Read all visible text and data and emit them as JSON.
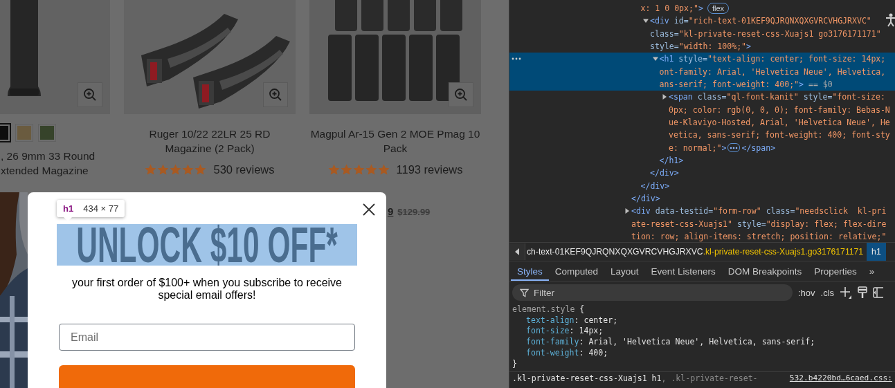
{
  "page": {
    "products": [
      {
        "swatches": [
          {
            "color": "#0e0e0e",
            "selected": true
          },
          {
            "color": "#6a5b3f",
            "selected": false
          },
          {
            "color": "#36432a",
            "selected": false
          }
        ],
        "title_lines": [
          ", 26 9mm 33 Round",
          "xtended Magazine"
        ]
      },
      {
        "title_lines": [
          "Ruger 10/22 22LR 25 RD",
          "Magazine (2 Pack)"
        ],
        "stars": 5,
        "reviews": "530 reviews"
      },
      {
        "title_lines": [
          "Magpul Ar-15 Gen 2 MOE Pmag 10",
          "Pack"
        ],
        "stars": 5,
        "reviews": "1193 reviews",
        "price": {
          "sale": "9",
          "regular": "$129.99"
        }
      }
    ]
  },
  "popup": {
    "inspect_tooltip": {
      "tag": "h1",
      "size": "434 × 77"
    },
    "heading": "UNLOCK $10 OFF*",
    "heading_highlighted": true,
    "description": "your first order of $100+ when you subscribe to receive special email offers!",
    "email_field": {
      "placeholder": "Email"
    }
  },
  "devtools": {
    "elements_tree": [
      {
        "children": [
          {
            "lines": [
              [
                {
                  "kind": "code",
                  "tokens": [
                    {
                      "kind": "value",
                      "text": "x: 1 0 0px;\""
                    },
                    {
                      "kind": "tag",
                      "text": ">"
                    }
                  ]
                },
                {
                  "kind": "badge",
                  "text": "flex"
                }
              ]
            ],
            "children": [
              {
                "expanded": true,
                "selected": false,
                "lines": [
                  [
                    {
                      "kind": "code",
                      "tokens": [
                        {
                          "kind": "tag",
                          "text": "<div"
                        },
                        {
                          "kind": "attr",
                          "text": " id="
                        },
                        {
                          "kind": "value",
                          "text": "\"rich-text-01KEF9QJRQNXQXGVRCVHGJRXVC\""
                        }
                      ]
                    }
                  ],
                  [
                    {
                      "kind": "code",
                      "tokens": [
                        {
                          "kind": "attr",
                          "text": "class="
                        },
                        {
                          "kind": "value",
                          "text": "\"kl-private-reset-css-Xuajs1 go3176171171\""
                        }
                      ]
                    }
                  ],
                  [
                    {
                      "kind": "code",
                      "tokens": [
                        {
                          "kind": "attr",
                          "text": "style="
                        },
                        {
                          "kind": "value",
                          "text": "\"width: 100%;\""
                        },
                        {
                          "kind": "tag",
                          "text": ">"
                        }
                      ]
                    }
                  ]
                ],
                "children": [
                  {
                    "expanded": true,
                    "selected": true,
                    "lines": [
                      [
                        {
                          "kind": "code",
                          "tokens": [
                            {
                              "kind": "tag",
                              "text": "<h1"
                            },
                            {
                              "kind": "attr",
                              "text": " style="
                            },
                            {
                              "kind": "value",
                              "text": "\"text-align: center; font-size: 14px;"
                            }
                          ]
                        }
                      ],
                      [
                        {
                          "kind": "code",
                          "tokens": [
                            {
                              "kind": "value",
                              "text": "ont-family: Arial, 'Helvetica Neue', Helvetica,"
                            }
                          ]
                        }
                      ],
                      [
                        {
                          "kind": "code",
                          "tokens": [
                            {
                              "kind": "value",
                              "text": "ans-serif; font-weight: 400;\""
                            },
                            {
                              "kind": "tag",
                              "text": ">"
                            },
                            {
                              "kind": "hint",
                              "text": " == $0"
                            }
                          ]
                        }
                      ]
                    ],
                    "children": [
                      {
                        "expanded": false,
                        "selected": false,
                        "lines": [
                          [
                            {
                              "kind": "code",
                              "tokens": [
                                {
                                  "kind": "tag",
                                  "text": "<span"
                                },
                                {
                                  "kind": "attr",
                                  "text": " class="
                                },
                                {
                                  "kind": "value",
                                  "text": "\"ql-font-kanit\""
                                },
                                {
                                  "kind": "attr",
                                  "text": " style="
                                },
                                {
                                  "kind": "value",
                                  "text": "\"font-size:"
                                }
                              ]
                            }
                          ],
                          [
                            {
                              "kind": "code",
                              "tokens": [
                                {
                                  "kind": "value",
                                  "text": "0px; color: rgb(0, 0, 0); font-family: Bebas-N"
                                }
                              ]
                            }
                          ],
                          [
                            {
                              "kind": "code",
                              "tokens": [
                                {
                                  "kind": "value",
                                  "text": "ue-Klaviyo-Hosted, Arial, 'Helvetica Neue', He"
                                }
                              ]
                            }
                          ],
                          [
                            {
                              "kind": "code",
                              "tokens": [
                                {
                                  "kind": "value",
                                  "text": "vetica, sans-serif; font-weight: 400; font-sty"
                                }
                              ]
                            }
                          ],
                          [
                            {
                              "kind": "code",
                              "tokens": [
                                {
                                  "kind": "value",
                                  "text": "e: normal;\""
                                },
                                {
                                  "kind": "tag",
                                  "text": ">"
                                }
                              ]
                            },
                            {
                              "kind": "ellipsis"
                            },
                            {
                              "kind": "code",
                              "tokens": [
                                {
                                  "kind": "tag",
                                  "text": "</span>"
                                }
                              ]
                            }
                          ]
                        ]
                      }
                    ],
                    "closing": [
                      {
                        "kind": "tag",
                        "text": "</h1>"
                      }
                    ]
                  }
                ],
                "closing": [
                  {
                    "kind": "tag",
                    "text": "</div>"
                  }
                ]
              }
            ],
            "closing": [
              {
                "kind": "tag",
                "text": "</div>"
              }
            ]
          }
        ],
        "closing": [
          {
            "kind": "tag",
            "text": "</div>"
          }
        ]
      },
      {
        "expanded": false,
        "selected": false,
        "lines": [
          [
            {
              "kind": "code",
              "tokens": [
                {
                  "kind": "tag",
                  "text": "<div"
                },
                {
                  "kind": "attr",
                  "text": " data-testid="
                },
                {
                  "kind": "value",
                  "text": "\"form-row\""
                },
                {
                  "kind": "attr",
                  "text": " class="
                },
                {
                  "kind": "value",
                  "text": "\"needsclick  kl-pri"
                }
              ]
            }
          ],
          [
            {
              "kind": "code",
              "tokens": [
                {
                  "kind": "value",
                  "text": "ate-reset-css-Xuajs1\""
                },
                {
                  "kind": "attr",
                  "text": " style="
                },
                {
                  "kind": "value",
                  "text": "\"display: flex; flex-dire"
                }
              ]
            }
          ],
          [
            {
              "kind": "code",
              "tokens": [
                {
                  "kind": "value",
                  "text": "tion: row; align-items: stretch; position: relative;\""
                }
              ]
            }
          ]
        ]
      }
    ],
    "breadcrumb": {
      "parts": [
        {
          "kind": "id",
          "text": "ch-text-01KEF9QJRQNXQXGVRCVHGJRXVC"
        },
        {
          "kind": "class",
          "text": ".kl-private-reset-css-Xuajs1.go3176171171"
        }
      ],
      "current": "h1"
    },
    "tabs": [
      {
        "label": "Styles",
        "selected": true
      },
      {
        "label": "Computed",
        "selected": false
      },
      {
        "label": "Layout",
        "selected": false
      },
      {
        "label": "Event Listeners",
        "selected": false
      },
      {
        "label": "DOM Breakpoints",
        "selected": false
      },
      {
        "label": "Properties",
        "selected": false
      },
      {
        "label": "»",
        "selected": false
      }
    ],
    "filter": {
      "placeholder": "Filter"
    },
    "toggles": [
      ":hov",
      ".cls"
    ],
    "rules": [
      {
        "selector": [
          {
            "kind": "inline",
            "text": "element.style"
          },
          {
            "kind": "plain",
            "text": " {"
          }
        ],
        "declarations": [
          [
            {
              "kind": "property",
              "text": "text-align"
            },
            {
              "kind": "plain",
              "text": ": center;"
            }
          ],
          [
            {
              "kind": "property",
              "text": "font-size"
            },
            {
              "kind": "plain",
              "text": ": 14px;"
            }
          ],
          [
            {
              "kind": "property",
              "text": "font-family"
            },
            {
              "kind": "plain",
              "text": ": Arial, 'Helvetica Neue', Helvetica, sans-serif;"
            }
          ],
          [
            {
              "kind": "property",
              "text": "font-weight"
            },
            {
              "kind": "plain",
              "text": ": 400;"
            }
          ]
        ],
        "closing": [
          {
            "kind": "plain",
            "text": "}"
          }
        ]
      },
      {
        "selector": [
          {
            "kind": "plain",
            "text": ".kl-private-reset-css-Xuajs1 h1"
          },
          {
            "kind": "nomatch",
            "text": ", .kl-private-reset-"
          }
        ],
        "source": "532.b4220bd…6caed.css:"
      }
    ]
  }
}
